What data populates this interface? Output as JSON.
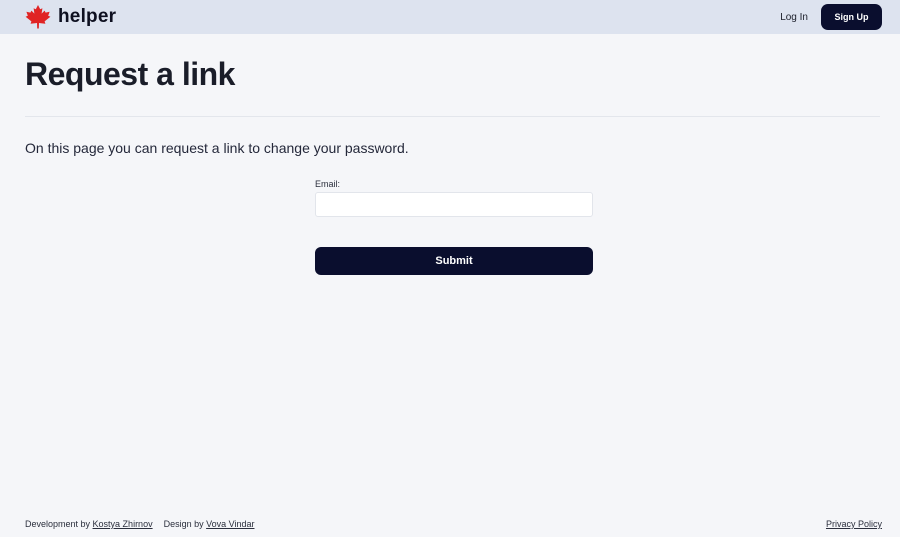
{
  "header": {
    "brand_name": "helper",
    "login_label": "Log In",
    "signup_label": "Sign Up",
    "logo_icon": "maple-leaf-icon",
    "logo_color": "#e02424"
  },
  "main": {
    "title": "Request a link",
    "description": "On this page you can request a link to change your password.",
    "form": {
      "email_label": "Email:",
      "email_value": "",
      "email_placeholder": "",
      "submit_label": "Submit"
    }
  },
  "footer": {
    "development_prefix": "Development by",
    "development_author": "Kostya Zhirnov",
    "design_prefix": "Design by",
    "design_author": "Vova Vindar",
    "privacy_label": "Privacy Policy"
  },
  "colors": {
    "header_bg": "#dde3ef",
    "page_bg": "#f5f6f9",
    "primary_button": "#0a0e2e"
  }
}
